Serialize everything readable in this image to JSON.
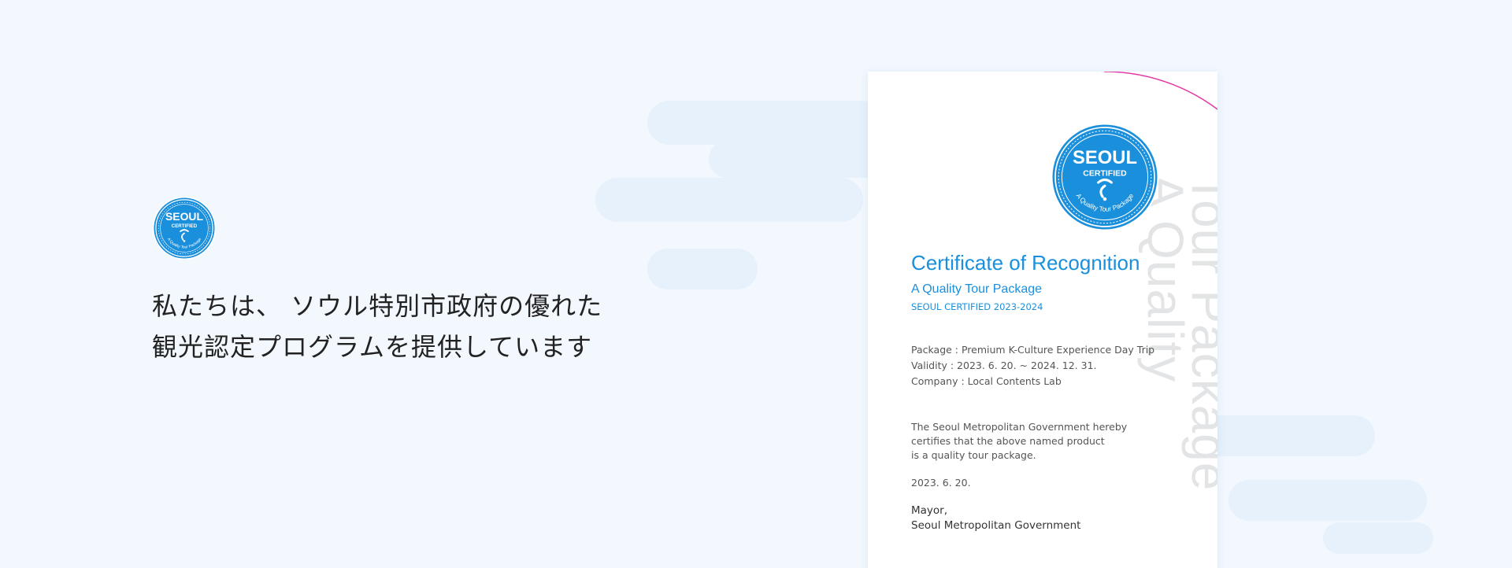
{
  "headline": {
    "line1": "私たちは、 ソウル特別市政府の優れた",
    "line2": "観光認定プログラムを提供しています"
  },
  "badge": {
    "top_text": "SEOUL",
    "mid_text": "CERTIFIED",
    "ring_text": "A Quality Tour Package",
    "color": "#1a8fdc"
  },
  "certificate": {
    "title": "Certificate of Recognition",
    "subtitle": "A Quality Tour Package",
    "year_label": "SEOUL CERTIFIED 2023-2024",
    "package_line": "Package : Premium K-Culture Experience Day Trip",
    "validity_line": "Validity : 2023. 6. 20. ~ 2024. 12. 31.",
    "company_line": "Company : Local Contents Lab",
    "statement_line1": "The Seoul Metropolitan Government hereby",
    "statement_line2": "certifies that the above named product",
    "statement_line3": "is a quality tour package.",
    "date": "2023. 6. 20.",
    "signer_title": "Mayor,",
    "signer_org": "Seoul Metropolitan Government",
    "watermark_line1": "Tour Package",
    "watermark_line2": "A Quality"
  },
  "colors": {
    "accent": "#1a8fdc",
    "arc": "#e23aa8",
    "background": "#f2f8fe"
  }
}
